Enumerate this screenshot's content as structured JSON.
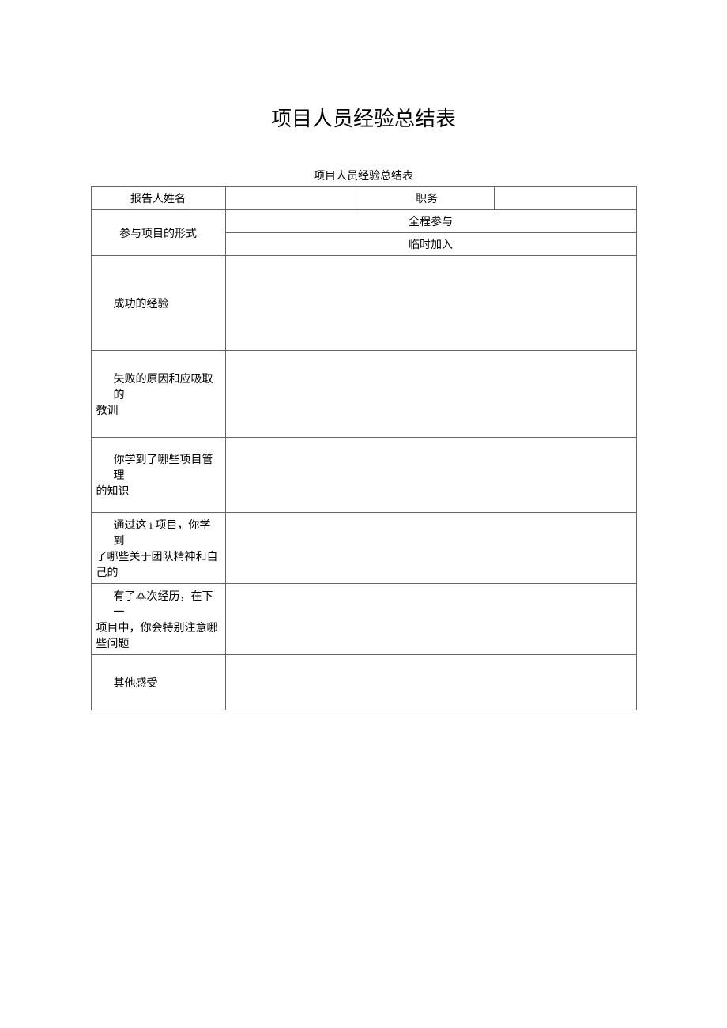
{
  "title": "项目人员经验总结表",
  "caption": "项目人员经验总结表",
  "labels": {
    "reporterName": "报告人姓名",
    "position": "职务",
    "participationForm": "参与项目的形式",
    "fullParticipation": "全程参与",
    "tempJoin": "临时加入",
    "successExp": "成功的经验",
    "failReason_line1": "失败的原因和应吸取的",
    "failReason_line2": "教训",
    "pmKnowledge_line1": "你学到了哪些项目管理",
    "pmKnowledge_line2": "的知识",
    "teamSpirit_line1": "通过这 i 项目，你学到",
    "teamSpirit_line2": "了哪些关于团队精神和自",
    "teamSpirit_line3": "己的",
    "nextAttention_line1": "有了本次经历，在下一",
    "nextAttention_line2": "项目中，你会特别注意哪",
    "nextAttention_line3": "些问题",
    "otherFeelings": "其他感受"
  },
  "values": {
    "reporterName": "",
    "position": "",
    "successExp": "",
    "failReason": "",
    "pmKnowledge": "",
    "teamSpirit": "",
    "nextAttention": "",
    "otherFeelings": ""
  }
}
